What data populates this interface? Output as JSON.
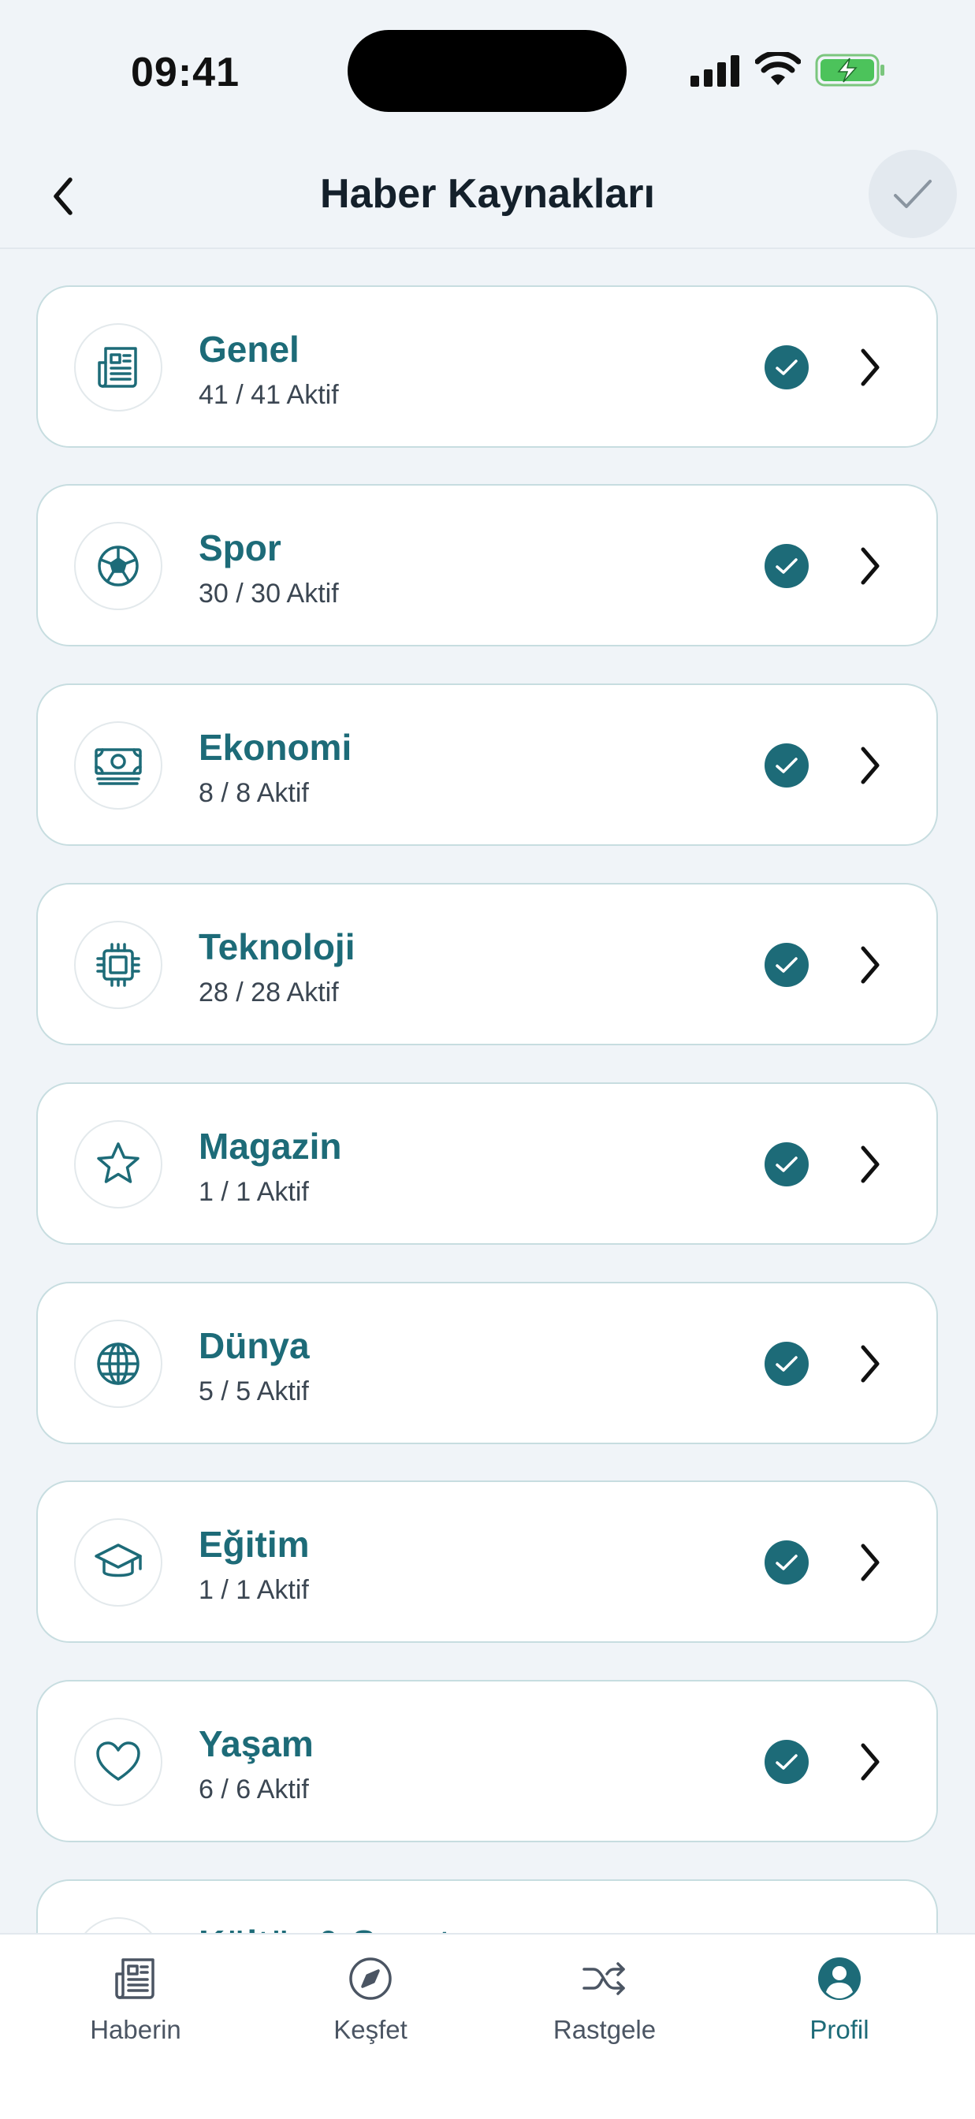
{
  "status_bar": {
    "time": "09:41"
  },
  "header": {
    "title": "Haber Kaynakları",
    "back_icon": "chevron-left-icon",
    "confirm_icon": "checkmark-icon"
  },
  "colors": {
    "accent": "#1D6B78",
    "card_border": "#C7DDE0",
    "background": "#F0F4F8"
  },
  "categories": [
    {
      "name": "Genel",
      "count": "41 / 41 Aktif",
      "icon": "newspaper-icon"
    },
    {
      "name": "Spor",
      "count": "30 / 30 Aktif",
      "icon": "soccer-ball-icon"
    },
    {
      "name": "Ekonomi",
      "count": "8 / 8 Aktif",
      "icon": "money-icon"
    },
    {
      "name": "Teknoloji",
      "count": "28 / 28 Aktif",
      "icon": "chip-icon"
    },
    {
      "name": "Magazin",
      "count": "1 / 1 Aktif",
      "icon": "star-icon"
    },
    {
      "name": "Dünya",
      "count": "5 / 5 Aktif",
      "icon": "globe-icon"
    },
    {
      "name": "Eğitim",
      "count": "1 / 1 Aktif",
      "icon": "graduation-cap-icon"
    },
    {
      "name": "Yaşam",
      "count": "6 / 6 Aktif",
      "icon": "heart-icon"
    },
    {
      "name": "Kültür & Sanat",
      "count": "",
      "icon": "palette-icon"
    }
  ],
  "tabs": [
    {
      "label": "Haberin",
      "icon": "newspaper-icon",
      "active": false
    },
    {
      "label": "Keşfet",
      "icon": "compass-icon",
      "active": false
    },
    {
      "label": "Rastgele",
      "icon": "shuffle-icon",
      "active": false
    },
    {
      "label": "Profil",
      "icon": "profile-icon",
      "active": true
    }
  ]
}
